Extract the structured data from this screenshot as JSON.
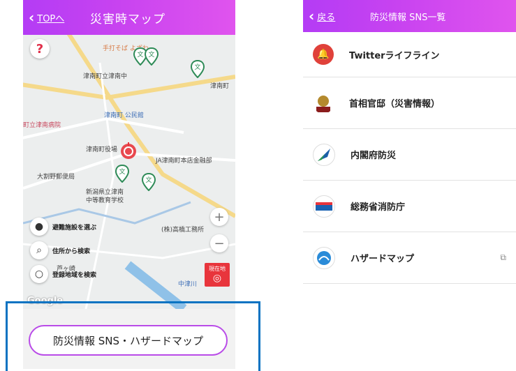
{
  "left": {
    "header": {
      "back_label": "TOPへ",
      "title": "災害時マップ"
    },
    "help_label": "?",
    "map": {
      "labels": {
        "tedachi": "手打そば よざわ",
        "school_mid": "津南町立津南中",
        "tsunan_town": "津南町",
        "kominkan": "津南町 公民館",
        "hospital": "町立津南病院",
        "yakuba": "津南町役場",
        "ja": "JA津南町本店金融部",
        "post": "大割野郵便局",
        "kenritsu1": "新潟県立津南",
        "kenritsu2": "中等教育学校",
        "takahashi": "(株)高橋工務所",
        "ashigasaki": "芦ヶ崎",
        "nakatsugawa": "中津川"
      },
      "zoom_in": "+",
      "zoom_out": "−",
      "locate_label": "現在地",
      "controls": {
        "choose_facility": "避難施設を選ぶ",
        "search_address": "住所から検索",
        "search_registered": "登録地域を検索"
      },
      "google": "Google"
    },
    "sns_button": "防災情報 SNS・ハザードマップ"
  },
  "right": {
    "header": {
      "back_label": "戻る",
      "title": "防災情報 SNS一覧"
    },
    "items": [
      {
        "label": "Twitterライフライン",
        "icon": "bell-icon"
      },
      {
        "label": "首相官邸（災害情報）",
        "icon": "kantei-crest-icon"
      },
      {
        "label": "内閣府防災",
        "icon": "cabinet-office-icon"
      },
      {
        "label": "総務省消防庁",
        "icon": "fdma-icon"
      },
      {
        "label": "ハザードマップ",
        "icon": "hazard-map-icon",
        "external": true
      }
    ]
  },
  "colors": {
    "header_gradient_start": "#b43cf5",
    "header_gradient_end": "#e054ee",
    "frame_blue": "#0a73c2",
    "accent_red": "#e8353c",
    "pin_green": "#2e8b57"
  }
}
